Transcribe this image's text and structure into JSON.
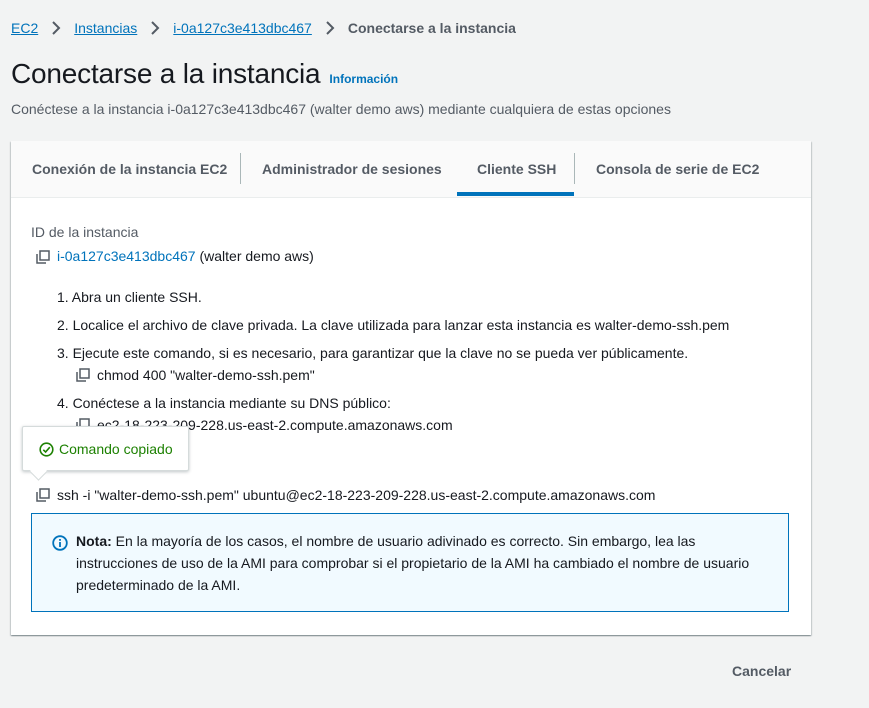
{
  "breadcrumb": {
    "items": [
      "EC2",
      "Instancias",
      "i-0a127c3e413dbc467"
    ],
    "current": "Conectarse a la instancia"
  },
  "header": {
    "title": "Conectarse a la instancia",
    "info": "Información",
    "subtitle": "Conéctese a la instancia i-0a127c3e413dbc467 (walter demo aws) mediante cualquiera de estas opciones"
  },
  "tabs": [
    {
      "label": "Conexión de la instancia EC2",
      "active": false
    },
    {
      "label": "Administrador de sesiones",
      "active": false
    },
    {
      "label": "Cliente SSH",
      "active": true
    },
    {
      "label": "Consola de serie de EC2",
      "active": false
    }
  ],
  "instance": {
    "label": "ID de la instancia",
    "id": "i-0a127c3e413dbc467",
    "name": "(walter demo aws)"
  },
  "steps": {
    "s1": "1. Abra un cliente SSH.",
    "s2": "2. Localice el archivo de clave privada. La clave utilizada para lanzar esta instancia es walter-demo-ssh.pem",
    "s3": "3. Ejecute este comando, si es necesario, para garantizar que la clave no se pueda ver públicamente.",
    "s3_cmd": "chmod 400 \"walter-demo-ssh.pem\"",
    "s4": "4. Conéctese a la instancia mediante su DNS público:",
    "s4_dns": "ec2-18-223-209-228.us-east-2.compute.amazonaws.com",
    "ssh_cmd": "ssh -i \"walter-demo-ssh.pem\" ubuntu@ec2-18-223-209-228.us-east-2.compute.amazonaws.com"
  },
  "tooltip": {
    "text": "Comando copiado"
  },
  "note": {
    "bold": "Nota:",
    "text": " En la mayoría de los casos, el nombre de usuario adivinado es correcto. Sin embargo, lea las instrucciones de uso de la AMI para comprobar si el propietario de la AMI ha cambiado el nombre de usuario predeterminado de la AMI."
  },
  "footer": {
    "cancel": "Cancelar"
  },
  "colors": {
    "link": "#0073bb",
    "success": "#1d8102",
    "text": "#16191f",
    "muted": "#545b64",
    "background": "#f2f3f3"
  },
  "icons": [
    "chevron-right-icon",
    "copy-icon",
    "check-circle-icon",
    "info-circle-icon"
  ]
}
